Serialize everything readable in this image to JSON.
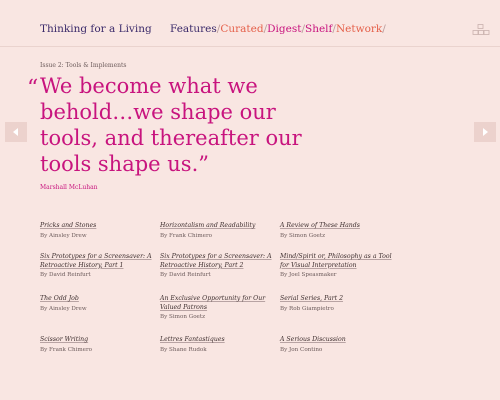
{
  "header": {
    "site_title": "Thinking for a Living",
    "nav": [
      {
        "label": "Features",
        "color": "#3b2a6a"
      },
      {
        "label": "Curated",
        "color": "#e5604a"
      },
      {
        "label": "Digest",
        "color": "#c8147e"
      },
      {
        "label": "Shelf",
        "color": "#c8147e"
      },
      {
        "label": "Network",
        "color": "#e5604a"
      }
    ],
    "nav_separator": "/"
  },
  "issue": "Issue 2: Tools & Implements",
  "quote": {
    "open_mark": "“",
    "text": "We become what we behold…we shape our tools, and thereafter our tools shape us.”",
    "author": "Marshall McLuhan"
  },
  "articles": [
    {
      "title": "Pricks and Stones",
      "by": "By Ainsley Drew"
    },
    {
      "title": "Horizontalism and Readability",
      "by": "By Frank Chimero"
    },
    {
      "title": "A Review of These Hands",
      "by": "By Simon Goetz"
    },
    {
      "title": "Six Prototypes for a Screensaver: A Retroactive History, Part 1",
      "by": "By David Reinfurt"
    },
    {
      "title": "Six Prototypes for a Screensaver: A Retroactive History, Part 2",
      "by": "By David Reinfurt"
    },
    {
      "title": "Mind/Spirit or, Philosophy as a Tool for Visual Interpretation",
      "by": "By Joel Speasmaker"
    },
    {
      "title": "The Odd Job",
      "by": "By Ainsley Drew"
    },
    {
      "title": "An Exclusive Opportunity for Our Valued Patrons",
      "by": "By Simon Goetz"
    },
    {
      "title": "Serial Series, Part 2",
      "by": "By Rob Giampietro"
    },
    {
      "title": "Scissor Writing",
      "by": "By Frank Chimero"
    },
    {
      "title": "Lettres Fantastiques",
      "by": "By Shane Rudok"
    },
    {
      "title": "A Serious Discussion",
      "by": "By Jon Contino"
    }
  ]
}
